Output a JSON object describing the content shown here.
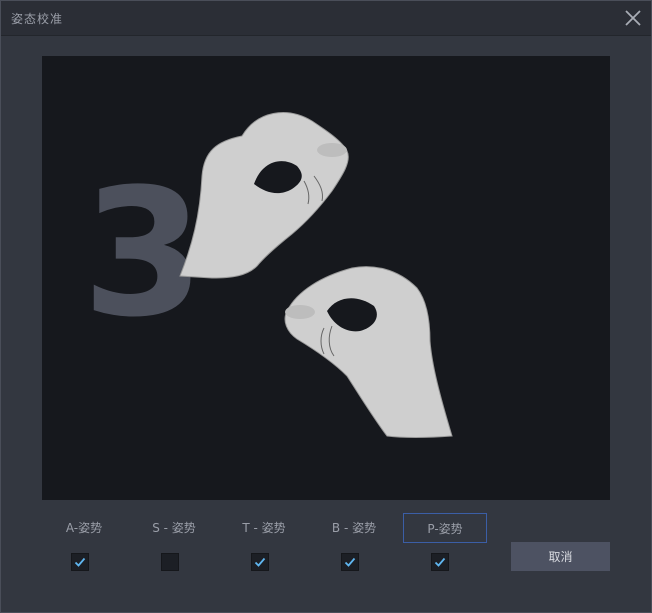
{
  "window": {
    "title": "姿态校准"
  },
  "icons": {
    "close": "close-icon",
    "check": "check-icon"
  },
  "stage": {
    "countdown": "3",
    "illustration": "hands-pinch-gesture"
  },
  "poses": [
    {
      "label": "A-姿势",
      "checked": true,
      "selected": false
    },
    {
      "label": "S - 姿势",
      "checked": false,
      "selected": false
    },
    {
      "label": "T - 姿势",
      "checked": true,
      "selected": false
    },
    {
      "label": "B - 姿势",
      "checked": true,
      "selected": false
    },
    {
      "label": "P-姿势",
      "checked": true,
      "selected": true
    }
  ],
  "buttons": {
    "cancel": "取消"
  },
  "colors": {
    "accent": "#3b5ea6",
    "check": "#5fb6f0"
  }
}
